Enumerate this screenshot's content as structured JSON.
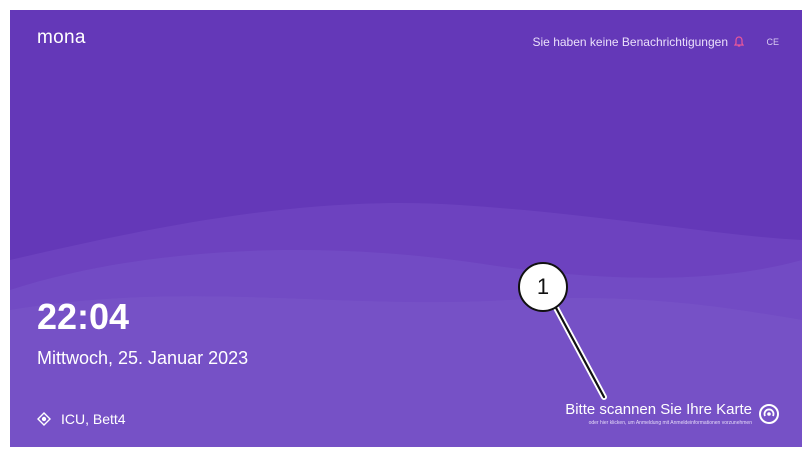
{
  "app": {
    "brand": "mona",
    "ce_mark": "CE"
  },
  "header": {
    "notifications_text": "Sie haben keine Benachrichtigungen"
  },
  "lock_screen": {
    "time": "22:04",
    "date": "Mittwoch, 25. Januar 2023",
    "location": "ICU, Bett4",
    "scan_title": "Bitte scannen Sie Ihre Karte",
    "scan_subtitle": "oder hier klicken, um Anmeldung mit Anmeldeinformationen vorzunehmen"
  },
  "annotation": {
    "callout_number": "1"
  },
  "colors": {
    "background": "#6438b8",
    "bell_accent": "#e9579a",
    "text": "#ffffff"
  },
  "icons": {
    "notification": "bell-icon",
    "location": "location-target-icon",
    "card_scan": "nfc-scan-icon"
  }
}
